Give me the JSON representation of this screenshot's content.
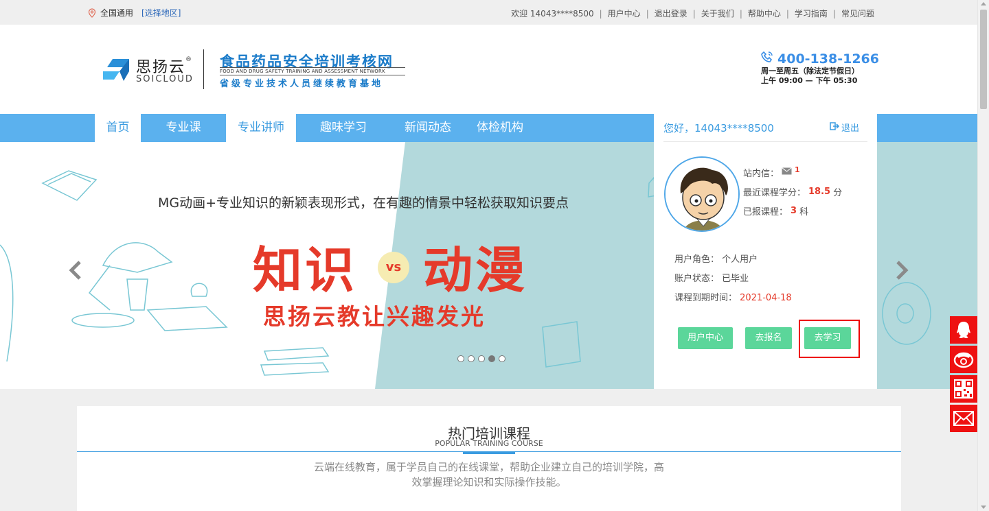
{
  "topbar": {
    "region": "全国通用",
    "region_link": "[选择地区]",
    "welcome": "欢迎 14043****8500",
    "links": [
      "用户中心",
      "退出登录",
      "关于我们",
      "帮助中心",
      "学习指南",
      "常见问题"
    ]
  },
  "header": {
    "brand_cn": "思扬云",
    "brand_reg": "®",
    "brand_en": "SOICLOUD",
    "site_title": "食品药品安全培训考核网",
    "site_en": "FOOD AND DRUG SAFETY TRAINING AND ASSESSMENT NETWORK",
    "site_sub": "省级专业技术人员继续教育基地",
    "phone": "400-138-1266",
    "hours_line1": "周一至周五（除法定节假日）",
    "hours_line2": "上午 09:00 — 下午 05:30"
  },
  "nav": {
    "items": [
      "首页",
      "专业课",
      "专业讲师",
      "趣味学习",
      "新闻动态",
      "体检机构"
    ]
  },
  "banner": {
    "tagline": "MG动画+专业知识的新颖表现形式，在有趣的情景中轻松获取知识要点",
    "left_word": "知识",
    "vs": "vs",
    "right_word": "动漫",
    "slogan": "思扬云教让兴趣发光",
    "slide_count": 5,
    "active_slide": 4
  },
  "user_panel": {
    "greeting": "您好，14043****8500",
    "logout": "退出",
    "messages_label": "站内信：",
    "messages_count": "1",
    "credits_label": "最近课程学分：",
    "credits_value": "18.5",
    "credits_unit": "分",
    "courses_label": "已报课程：",
    "courses_value": "3",
    "courses_unit": "科",
    "role_label": "用户角色：",
    "role_value": "个人用户",
    "status_label": "账户状态：",
    "status_value": "已毕业",
    "expire_label": "课程到期时间：",
    "expire_value": "2021-04-18",
    "btn_user_center": "用户中心",
    "btn_enroll": "去报名",
    "btn_study": "去学习"
  },
  "popular": {
    "title": "热门培训课程",
    "subtitle": "POPULAR TRAINING COURSE",
    "desc_line1": "云端在线教育，属于学员自己的在线课堂，帮助企业建立自己的培训学院，高",
    "desc_line2": "效掌握理论知识和实际操作技能。"
  },
  "float_icons": [
    "qq-icon",
    "phone-icon",
    "qrcode-icon",
    "mail-icon"
  ],
  "colors": {
    "accent": "#5bb1ee",
    "link": "#3a9be0",
    "red": "#e53a2a",
    "green": "#5bd69a",
    "float_red": "#e11111"
  }
}
